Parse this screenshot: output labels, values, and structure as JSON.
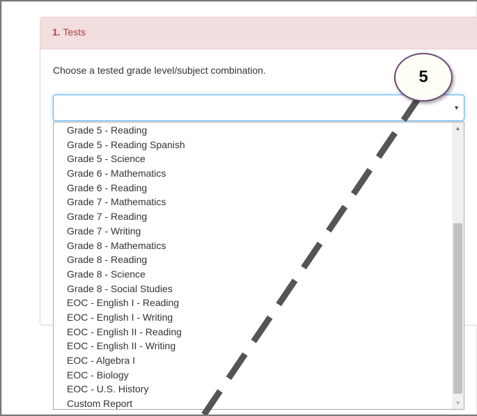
{
  "panel": {
    "heading_number": "1.",
    "heading_title": "Tests",
    "instruction": "Choose a tested grade level/subject combination."
  },
  "select": {
    "value": "",
    "arrow_icon": "caret-down-icon"
  },
  "dropdown": {
    "items": [
      "Grade 5 - Reading",
      "Grade 5 - Reading Spanish",
      "Grade 5 - Science",
      "Grade 6 - Mathematics",
      "Grade 6 - Reading",
      "Grade 7 - Mathematics",
      "Grade 7 - Reading",
      "Grade 7 - Writing",
      "Grade 8 - Mathematics",
      "Grade 8 - Reading",
      "Grade 8 - Science",
      "Grade 8 - Social Studies",
      "EOC - English I - Reading",
      "EOC - English I - Writing",
      "EOC - English II - Reading",
      "EOC - English II - Writing",
      "EOC - Algebra I",
      "EOC - Biology",
      "EOC - U.S. History",
      "Custom Report"
    ]
  },
  "callout": {
    "number": "5"
  },
  "colors": {
    "heading_bg": "#f2dede",
    "heading_text": "#a94442",
    "focus_border": "#66afe9",
    "callout_border": "#6b4a78",
    "dash": "#555555"
  }
}
